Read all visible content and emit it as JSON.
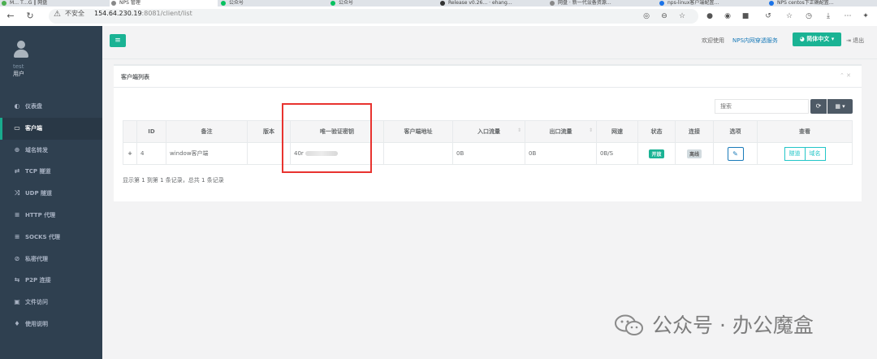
{
  "browser": {
    "tabs": [
      {
        "label": "M…  T…G  ‖ 网盘",
        "color": "#4caf50"
      },
      {
        "label": "NPS 管理",
        "color": "#888888"
      },
      {
        "label": "公众号",
        "color": "#07c160"
      },
      {
        "label": "公众号",
        "color": "#07c160"
      },
      {
        "label": "Release v0.26… · ehang…",
        "color": "#333333"
      },
      {
        "label": "网盘 · 新一代设备资源…",
        "color": "#888888"
      },
      {
        "label": "nps-linux客户端配置…",
        "color": "#1a73e8"
      },
      {
        "label": "NPS centos下正确配置…",
        "color": "#1a73e8"
      }
    ],
    "insecure_label": "不安全",
    "url_host": "154.64.230.19",
    "url_rest": ":8081/client/list",
    "warn_icon": "warning-icon"
  },
  "sidebar": {
    "username": "test",
    "role": "用户",
    "items": [
      {
        "label": "仪表盘",
        "icon": "dashboard-icon",
        "glyph": "◐"
      },
      {
        "label": "客户端",
        "icon": "desktop-icon",
        "glyph": "▭"
      },
      {
        "label": "域名转发",
        "icon": "globe-icon",
        "glyph": "⊕"
      },
      {
        "label": "TCP 隧道",
        "icon": "arrows-icon",
        "glyph": "⇄"
      },
      {
        "label": "UDP 隧道",
        "icon": "shuffle-icon",
        "glyph": "⤨"
      },
      {
        "label": "HTTP 代理",
        "icon": "server-icon",
        "glyph": "≡"
      },
      {
        "label": "SOCKS 代理",
        "icon": "server-icon",
        "glyph": "≡"
      },
      {
        "label": "私密代理",
        "icon": "eye-slash-icon",
        "glyph": "⊘"
      },
      {
        "label": "P2P 连接",
        "icon": "exchange-icon",
        "glyph": "⇆"
      },
      {
        "label": "文件访问",
        "icon": "briefcase-icon",
        "glyph": "▣"
      },
      {
        "label": "使用说明",
        "icon": "lightbulb-icon",
        "glyph": "♦"
      }
    ],
    "active_index": 1
  },
  "header": {
    "welcome": "欢迎使用",
    "brand": "NPS内网穿透服务",
    "language_button": "简体中文",
    "logout": "退出"
  },
  "panel": {
    "title": "客户端列表",
    "search_placeholder": "搜索",
    "columns": [
      "",
      "ID",
      "备注",
      "版本",
      "唯一验证密钥",
      "客户端地址",
      "入口流量",
      "出口流量",
      "网速",
      "状态",
      "连接",
      "选项",
      "查看"
    ],
    "rows": [
      {
        "expand": "+",
        "id": "4",
        "remark": "window客户端",
        "version": "",
        "key_prefix": "40r",
        "address": "",
        "in_flow": "0B",
        "out_flow": "0B",
        "speed": "0B/S",
        "status": "开放",
        "connection": "离线",
        "view_tunnel": "隧道",
        "view_domain": "域名"
      }
    ],
    "summary": "显示第 1 到第 1 条记录，总共 1 条记录"
  },
  "watermark": {
    "text": "公众号 · 办公魔盒"
  },
  "colors": {
    "sidebar_bg": "#2f4050",
    "accent": "#1ab394",
    "link": "#1a7bb9",
    "highlight_box": "#e8332f"
  }
}
